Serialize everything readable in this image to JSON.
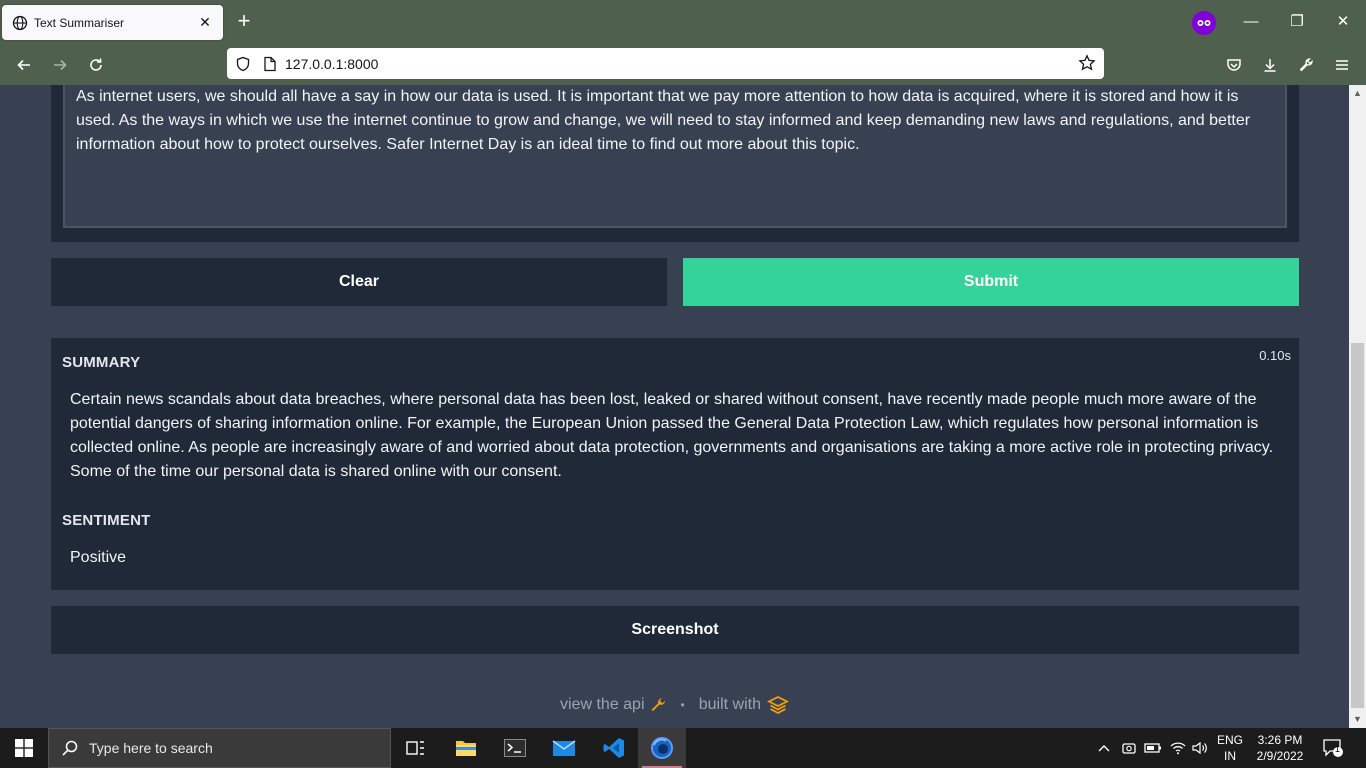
{
  "browser": {
    "tab_title": "Text Summariser",
    "url": "127.0.0.1:8000"
  },
  "app": {
    "input_text": "As internet users, we should all have a say in how our data is used. It is important that we pay more attention to how data is acquired, where it is stored and how it is used. As the ways in which we use the internet continue to grow and change, we will need to stay informed and keep demanding new laws and regulations, and better information about how to protect ourselves. Safer Internet Day is an ideal time to find out more about this topic.",
    "clear_label": "Clear",
    "submit_label": "Submit",
    "summary_label": "SUMMARY",
    "timer": "0.10s",
    "summary_text": "Certain news scandals about data breaches, where personal data has been lost, leaked or shared without consent, have recently made people much more aware of the potential dangers of sharing information online. For example, the European Union passed the General Data Protection Law, which regulates how personal information is collected online. As people are increasingly aware of and worried about data protection, governments and organisations are taking a more active role in protecting privacy. Some of the time our personal data is shared online with our consent.",
    "sentiment_label": "SENTIMENT",
    "sentiment_value": "Positive",
    "screenshot_label": "Screenshot",
    "footer_api": "view the api",
    "footer_dot": "•",
    "footer_built": "built with"
  },
  "taskbar": {
    "search_placeholder": "Type here to search",
    "lang_top": "ENG",
    "lang_bottom": "IN",
    "time": "3:26 PM",
    "date": "2/9/2022",
    "notification_count": "1"
  },
  "colors": {
    "accent": "#34d399",
    "panel": "#1f2937",
    "page_bg": "#374151",
    "chrome": "#50604e"
  }
}
